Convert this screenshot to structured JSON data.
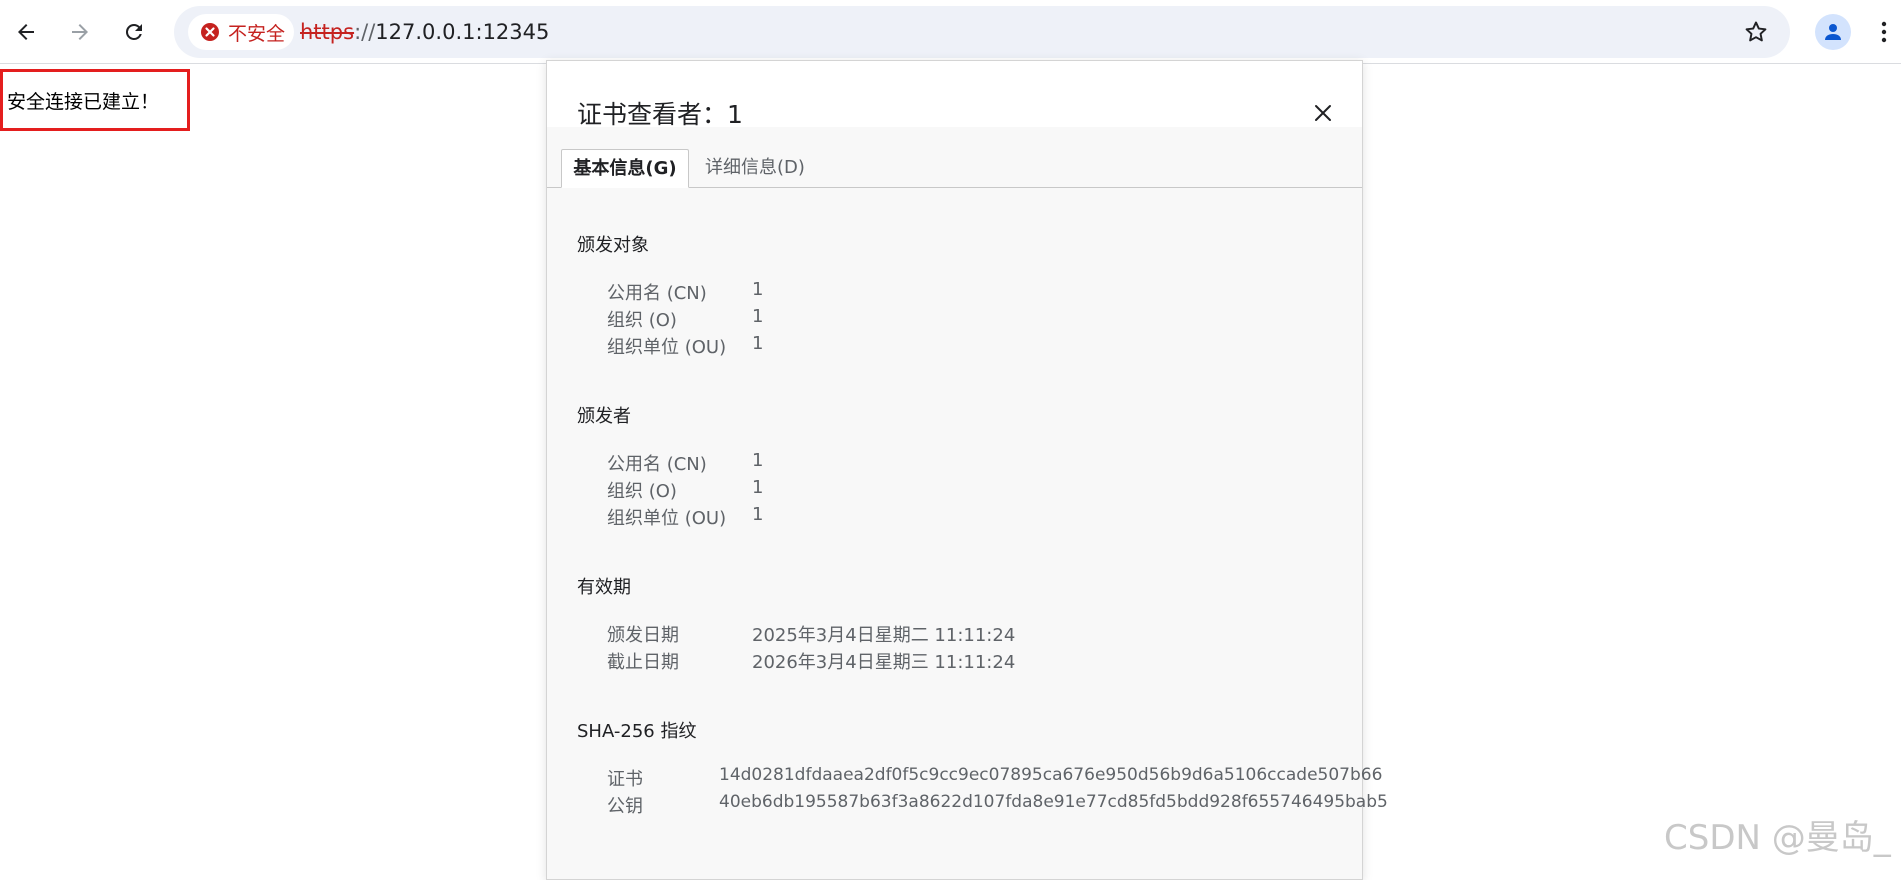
{
  "browser": {
    "security_label": "不安全",
    "url_scheme": "https",
    "url_separator": "://",
    "url_host": "127.0.0.1:12345"
  },
  "page": {
    "message": "安全连接已建立！"
  },
  "dialog": {
    "title": "证书查看者：1",
    "tabs": [
      {
        "label": "基本信息(G)",
        "active": true
      },
      {
        "label": "详细信息(D)",
        "active": false
      }
    ],
    "issued_to": {
      "heading": "颁发对象",
      "fields": [
        {
          "label": "公用名 (CN)",
          "value": "1"
        },
        {
          "label": "组织 (O)",
          "value": "1"
        },
        {
          "label": "组织单位 (OU)",
          "value": "1"
        }
      ]
    },
    "issued_by": {
      "heading": "颁发者",
      "fields": [
        {
          "label": "公用名 (CN)",
          "value": "1"
        },
        {
          "label": "组织 (O)",
          "value": "1"
        },
        {
          "label": "组织单位 (OU)",
          "value": "1"
        }
      ]
    },
    "validity": {
      "heading": "有效期",
      "fields": [
        {
          "label": "颁发日期",
          "value": "2025年3月4日星期二 11:11:24"
        },
        {
          "label": "截止日期",
          "value": "2026年3月4日星期三 11:11:24"
        }
      ]
    },
    "fingerprints": {
      "heading": "SHA-256 指纹",
      "fields": [
        {
          "label": "证书",
          "value": "14d0281dfdaaea2df0f5c9cc9ec07895ca676e950d56b9d6a5106ccade507b66"
        },
        {
          "label": "公钥",
          "value": "40eb6db195587b63f3a8622d107fda8e91e77cd85fd5bdd928f655746495bab5"
        }
      ]
    }
  },
  "watermark": "CSDN @曼岛_",
  "colors": {
    "insecure_red": "#c5221f",
    "highlight_border": "#e41e1e",
    "omnibox_bg": "#eef1f8",
    "dialog_bg": "#f8f8f8"
  },
  "icons": {
    "back": "arrow-left-icon",
    "forward": "arrow-right-icon",
    "reload": "reload-icon",
    "security": "error-circle-icon",
    "bookmark": "star-outline-icon",
    "profile": "person-icon",
    "menu": "kebab-menu-icon",
    "close": "close-icon"
  }
}
